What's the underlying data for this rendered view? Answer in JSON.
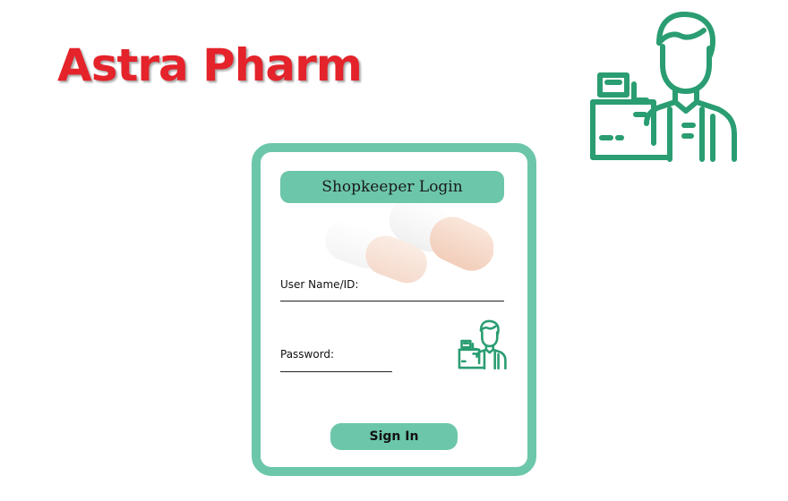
{
  "brand": {
    "name": "Astra Pharm",
    "color": "#e4232b"
  },
  "theme": {
    "accent": "#6cc6aa",
    "icon_green": "#2a9d72"
  },
  "login": {
    "title": "Shopkeeper Login",
    "username_label": "User Name/ID:",
    "username_value": "",
    "password_label": "Password:",
    "password_value": "",
    "submit_label": "Sign In"
  },
  "icons": {
    "hero": "shopkeeper-at-register-icon",
    "card": "shopkeeper-at-register-icon",
    "background": "pill-capsules"
  }
}
